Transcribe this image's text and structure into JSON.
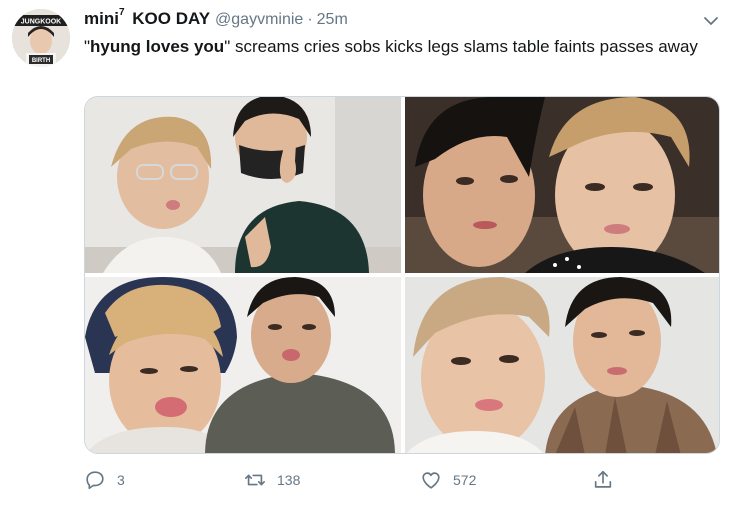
{
  "tweet": {
    "author": {
      "display_name": "mini",
      "superscript": "7",
      "display_name_suffix": "KOO DAY",
      "handle": "@gayvminie",
      "separator": "·",
      "time": "25m",
      "avatar_text_top": "JUNGKOOK",
      "avatar_text_bottom": "BIRTH"
    },
    "text": {
      "quote_open": "\"",
      "bold": "hyung loves you",
      "quote_close": "\"",
      "rest": " screams cries sobs kicks legs slams table faints passes away"
    },
    "media": {
      "photos": [
        "photo-1",
        "photo-2",
        "photo-3",
        "photo-4"
      ]
    },
    "actions": {
      "reply": {
        "icon": "reply-icon",
        "count": "3"
      },
      "retweet": {
        "icon": "retweet-icon",
        "count": "138"
      },
      "like": {
        "icon": "heart-icon",
        "count": "572"
      },
      "share": {
        "icon": "share-icon"
      }
    },
    "colors": {
      "text": "#14171a",
      "secondary": "#657786",
      "border": "#ccd6dd"
    }
  }
}
